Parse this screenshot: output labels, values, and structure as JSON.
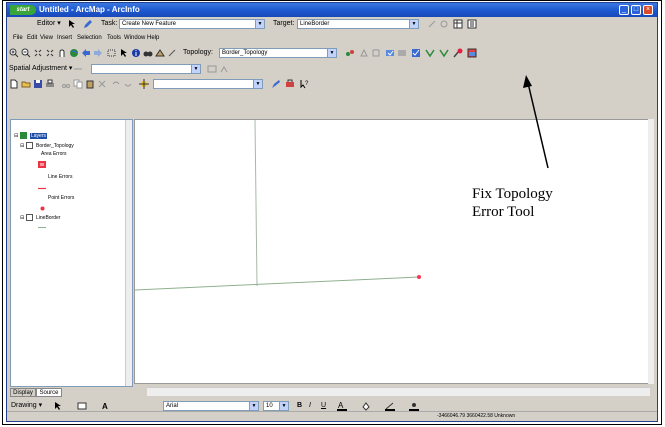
{
  "window": {
    "start_label": "start",
    "title": "Untitled - ArcMap - ArcInfo",
    "controls": [
      "_",
      "□",
      "×"
    ]
  },
  "editor_toolbar": {
    "editor_menu": "Editor ▾",
    "task_label": "Task:",
    "task_value": "Create New Feature",
    "target_label": "Target:",
    "target_value": "LineBorder"
  },
  "menu_bar": {
    "items": [
      "File",
      "Edit",
      "View",
      "Insert",
      "Selection",
      "Tools",
      "Window",
      "Help"
    ]
  },
  "topology_toolbar": {
    "topology_label": "Topology:",
    "topology_value": "Border_Topology"
  },
  "spatial_adjustment": {
    "label": "Spatial Adjustment ▾"
  },
  "toc": {
    "layers_title": "Layers",
    "group_name": "Border_Topology",
    "legend_items": [
      "Area Errors",
      "Line Errors",
      "Point Errors"
    ],
    "layer2_name": "LineBorder",
    "tabs": [
      "Display",
      "Source"
    ]
  },
  "draw_toolbar": {
    "drawing_menu": "Drawing ▾",
    "font_value": "Arial",
    "size_value": "10",
    "bold": "B",
    "italic": "I",
    "underline": "U"
  },
  "status_bar": {
    "coords": "-3466046.79  3660422.58 Unknown"
  },
  "annotation": {
    "line1": "Fix Topology",
    "line2": "Error Tool"
  },
  "colors": {
    "titlebar": "#1f5ad2",
    "chrome": "#d4d0c8",
    "feature_line": "#8fb08f",
    "error_point": "#ff3355"
  }
}
